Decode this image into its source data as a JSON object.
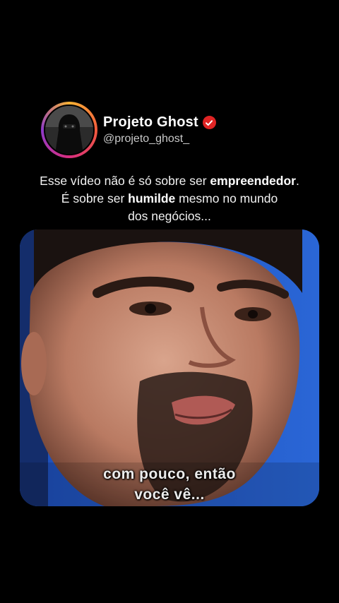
{
  "post": {
    "account_name": "Projeto Ghost",
    "handle": "@projeto_ghost_",
    "verified_icon": "verified-check-icon",
    "caption": {
      "line1_a": "Esse vídeo não é só sobre ser ",
      "line1_bold": "empreendedor",
      "line1_b": ".",
      "line2_a": "É sobre ser ",
      "line2_bold": "humilde",
      "line2_b": " mesmo no mundo",
      "line3": "dos negócios..."
    }
  },
  "video": {
    "subtitle_line1": "com pouco, então",
    "subtitle_line2": "você vê..."
  },
  "colors": {
    "background": "#000000",
    "verified": "#e02424",
    "video_backdrop": "#1e57c4"
  }
}
